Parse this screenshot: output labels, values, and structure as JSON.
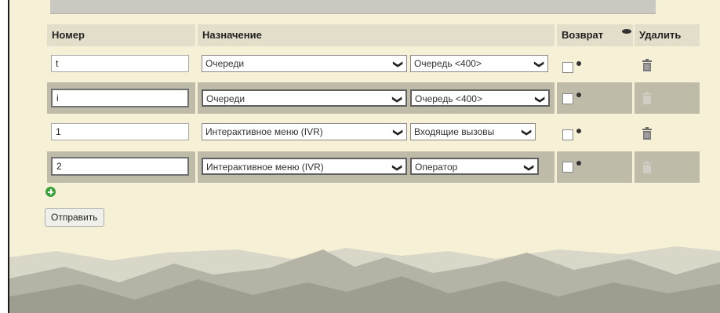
{
  "headers": {
    "number": "Номер",
    "destination": "Назначение",
    "return": "Возврат",
    "delete": "Удалить"
  },
  "rows": [
    {
      "number": "t",
      "type": "Очереди",
      "target": "Очередь <400>",
      "return_checked": false,
      "delete_enabled": true
    },
    {
      "number": "i",
      "type": "Очереди",
      "target": "Очередь <400>",
      "return_checked": false,
      "delete_enabled": false
    },
    {
      "number": "1",
      "type": "Интерактивное меню (IVR)",
      "target": "Входящие вызовы",
      "return_checked": false,
      "delete_enabled": true
    },
    {
      "number": "2",
      "type": "Интерактивное меню (IVR)",
      "target": "Оператор",
      "return_checked": false,
      "delete_enabled": false
    }
  ],
  "submit_label": "Отправить",
  "icons": {
    "add": "plus-circle-icon",
    "delete": "trash-icon",
    "chevron": "chevron-down-icon",
    "help": "help-dot-icon"
  },
  "colors": {
    "background": "#f6f0d6",
    "header_bg": "#e2dec9",
    "alt_row_bg": "#bebba8",
    "add_icon": "#3aa23a"
  }
}
